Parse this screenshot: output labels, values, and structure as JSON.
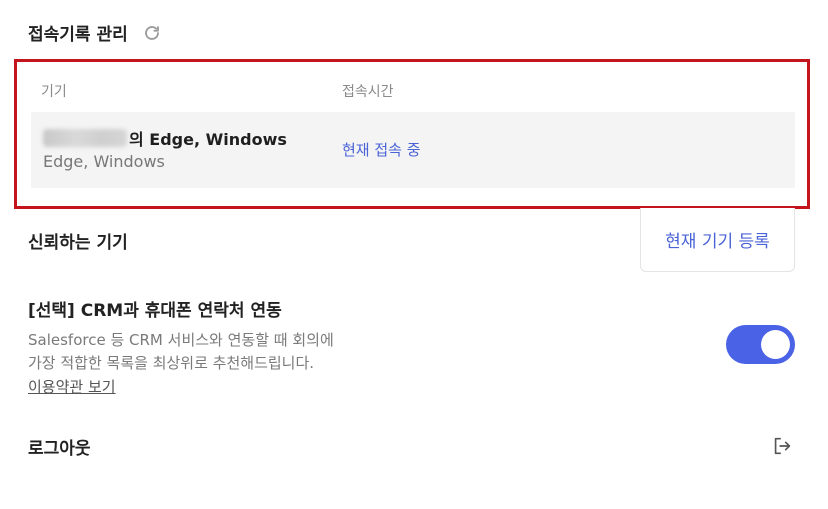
{
  "access_history": {
    "title": "접속기록 관리",
    "refresh_icon": "refresh-icon",
    "columns": {
      "device": "기기",
      "time": "접속시간"
    },
    "rows": [
      {
        "device_suffix": "의 Edge, Windows",
        "device_sub": "Edge, Windows",
        "status": "현재 접속 중"
      }
    ]
  },
  "trusted_devices": {
    "title": "신뢰하는 기기",
    "register_button": "현재 기기 등록"
  },
  "crm": {
    "title": "[선택] CRM과 휴대폰 연락처 연동",
    "description_line1": "Salesforce 등 CRM 서비스와 연동할 때 회의에",
    "description_line2": "가장 적합한 목록을 최상위로 추천해드립니다.",
    "terms_link": "이용약관 보기",
    "toggle_on": true
  },
  "logout": {
    "label": "로그아웃",
    "icon": "logout-icon"
  },
  "colors": {
    "accent": "#4a63e6",
    "highlight_border": "#c4141c",
    "row_bg": "#f4f4f5"
  }
}
